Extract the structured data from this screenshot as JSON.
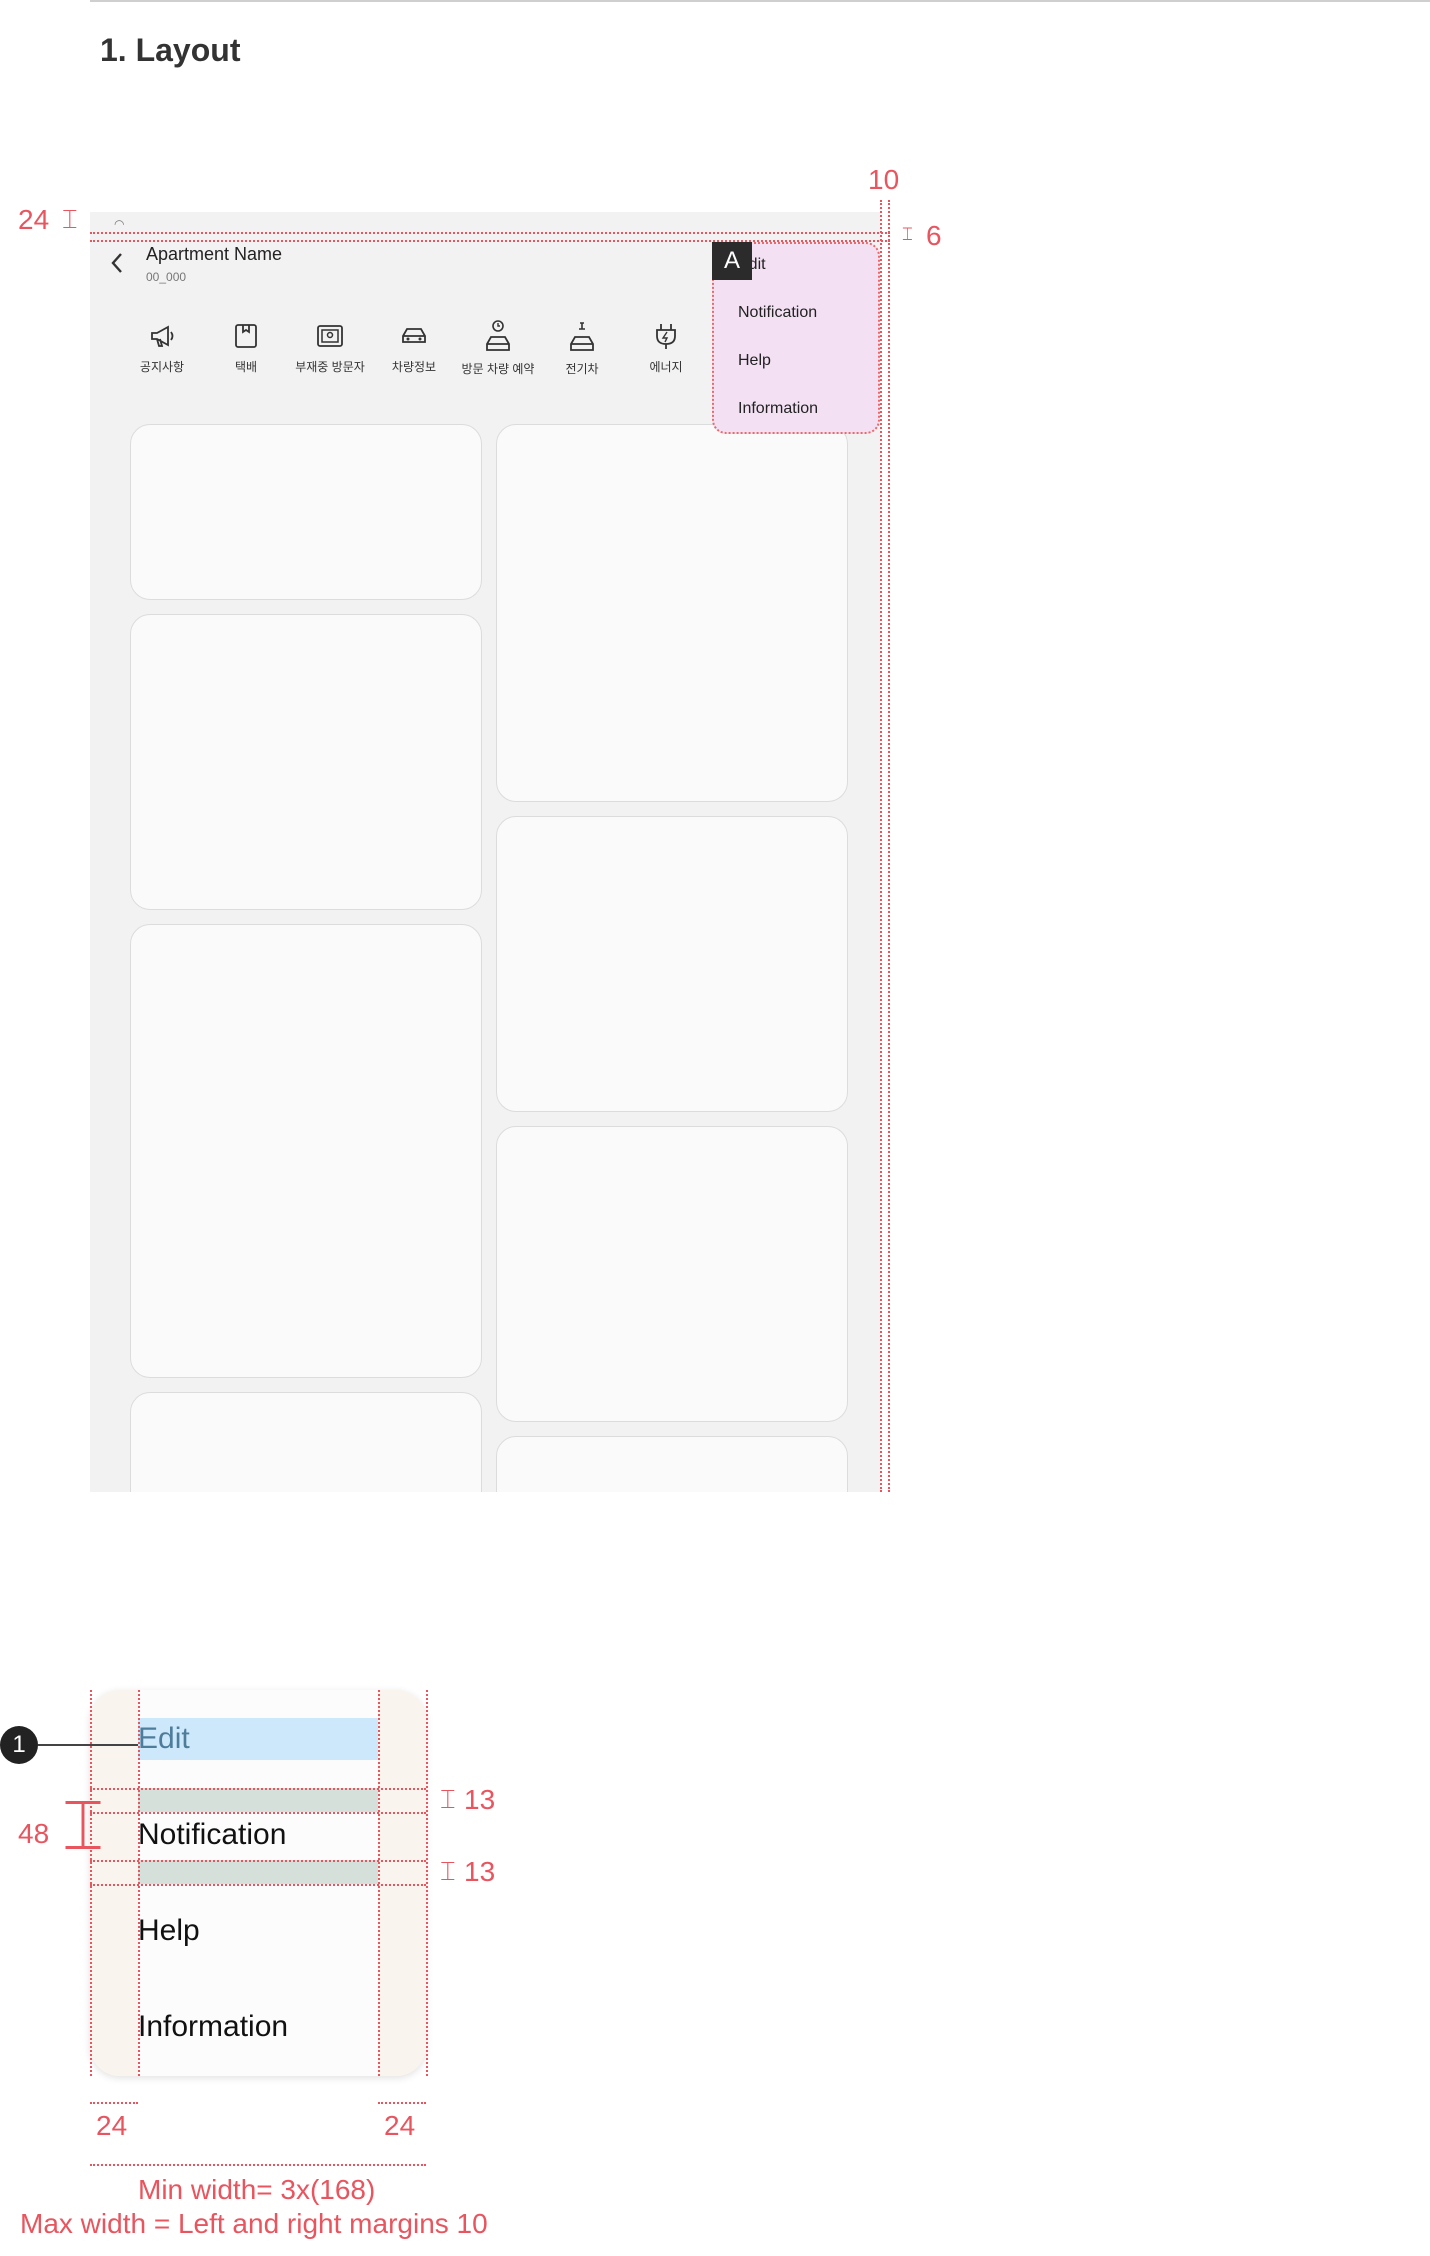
{
  "section": {
    "title": "1. Layout"
  },
  "appbar": {
    "title": "Apartment Name",
    "subtitle": "00_000",
    "back_icon": "chevron-left-icon"
  },
  "shortcuts": [
    {
      "label": "공지사항",
      "icon": "megaphone-icon"
    },
    {
      "label": "택배",
      "icon": "package-icon"
    },
    {
      "label": "부재중 방문자",
      "icon": "intercom-icon"
    },
    {
      "label": "차량정보",
      "icon": "car-icon"
    },
    {
      "label": "방문 차량 예약",
      "icon": "car-clock-icon"
    },
    {
      "label": "전기차",
      "icon": "ev-car-icon"
    },
    {
      "label": "에너지",
      "icon": "plug-icon"
    }
  ],
  "popup_menu": {
    "items": [
      "Edit",
      "Notification",
      "Help",
      "Information"
    ]
  },
  "annotations": {
    "badge": "A",
    "status_height": "24",
    "right_margin": "10",
    "top_gap": "6",
    "callout_number": "1",
    "item_height": "48",
    "padding_top": "13",
    "padding_bottom": "13",
    "side_left": "24",
    "side_right": "24",
    "min_width": "Min width= 3x(168)",
    "max_width": "Max width =  Left and right margins 10"
  },
  "colors": {
    "annotation_red": "#e8555f",
    "popup_bg": "#f3e1f3",
    "highlight_blue": "#cde8fb",
    "padding_green": "#d6e0db"
  }
}
